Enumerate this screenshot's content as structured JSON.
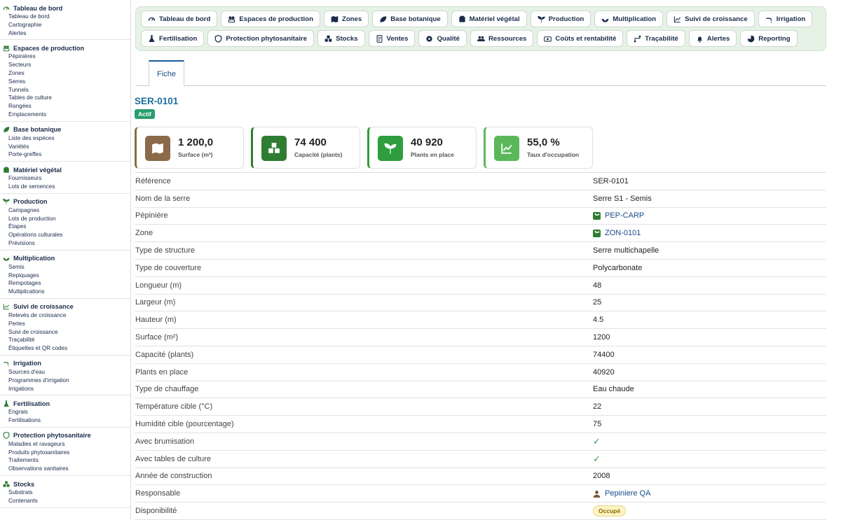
{
  "sidebar": [
    {
      "title": "Tableau de bord",
      "icon": "gauge-icon",
      "items": [
        "Tableau de bord",
        "Cartographie",
        "Alertes"
      ]
    },
    {
      "title": "Espaces de production",
      "icon": "nursery-icon",
      "items": [
        "Pépinières",
        "Secteurs",
        "Zones",
        "Serres",
        "Tunnels",
        "Tables de culture",
        "Rangées",
        "Emplacements"
      ]
    },
    {
      "title": "Base botanique",
      "icon": "leaf-icon",
      "items": [
        "Liste des espèces",
        "Variétés",
        "Porte-greffes"
      ]
    },
    {
      "title": "Matériel végétal",
      "icon": "seed-bag-icon",
      "items": [
        "Fournisseurs",
        "Lots de semences"
      ]
    },
    {
      "title": "Production",
      "icon": "sprout-icon",
      "items": [
        "Campagnes",
        "Lots de production",
        "Étapes",
        "Opérations culturales",
        "Prévisions"
      ]
    },
    {
      "title": "Multiplication",
      "icon": "plant-icon",
      "items": [
        "Semis",
        "Repiquages",
        "Rempotages",
        "Multiplications"
      ]
    },
    {
      "title": "Suivi de croissance",
      "icon": "growth-chart-icon",
      "items": [
        "Relevés de croissance",
        "Pertes",
        "Suivi de croissance",
        "Traçabilité",
        "Étiquettes et QR codes"
      ]
    },
    {
      "title": "Irrigation",
      "icon": "faucet-icon",
      "items": [
        "Sources d'eau",
        "Programmes d'irrigation",
        "Irrigations"
      ]
    },
    {
      "title": "Fertilisation",
      "icon": "flask-icon",
      "items": [
        "Engrais",
        "Fertilisations"
      ]
    },
    {
      "title": "Protection phytosanitaire",
      "icon": "shield-icon",
      "items": [
        "Maladies et ravageurs",
        "Produits phytosanitaires",
        "Traitements",
        "Observations sanitaires"
      ]
    },
    {
      "title": "Stocks",
      "icon": "boxes-icon",
      "items": [
        "Substrats",
        "Contenants"
      ]
    }
  ],
  "topnav": {
    "row1": [
      {
        "label": "Tableau de bord",
        "icon": "gauge-icon"
      },
      {
        "label": "Espaces de production",
        "icon": "nursery-icon"
      },
      {
        "label": "Zones",
        "icon": "map-icon"
      },
      {
        "label": "Base botanique",
        "icon": "leaf-icon"
      },
      {
        "label": "Matériel végétal",
        "icon": "seed-bag-icon"
      },
      {
        "label": "Production",
        "icon": "sprout-icon"
      },
      {
        "label": "Multiplication",
        "icon": "plant-icon"
      },
      {
        "label": "Suivi de croissance",
        "icon": "growth-chart-icon"
      },
      {
        "label": "Irrigation",
        "icon": "faucet-icon"
      }
    ],
    "row2": [
      {
        "label": "Fertilisation",
        "icon": "flask-icon"
      },
      {
        "label": "Protection phytosanitaire",
        "icon": "shield-icon"
      },
      {
        "label": "Stocks",
        "icon": "boxes-icon"
      },
      {
        "label": "Ventes",
        "icon": "receipt-icon"
      },
      {
        "label": "Qualité",
        "icon": "gear-badge-icon"
      },
      {
        "label": "Ressources",
        "icon": "users-icon"
      },
      {
        "label": "Coûts et rentabilité",
        "icon": "money-icon"
      },
      {
        "label": "Traçabilité",
        "icon": "route-icon"
      },
      {
        "label": "Alertes",
        "icon": "bell-icon"
      },
      {
        "label": "Reporting",
        "icon": "pie-chart-icon"
      }
    ]
  },
  "tabs": [
    {
      "label": "Fiche"
    }
  ],
  "record": {
    "title": "SER-0101",
    "status": "Actif"
  },
  "kpis": [
    {
      "value": "1 200,0",
      "label": "Surface (m²)",
      "color": "#8a6a4a",
      "icon": "map-icon"
    },
    {
      "value": "74 400",
      "label": "Capacité (plants)",
      "color": "#2e7d32",
      "icon": "boxes-icon"
    },
    {
      "value": "40 920",
      "label": "Plants en place",
      "color": "#2e9d3e",
      "icon": "seedling-icon"
    },
    {
      "value": "55,0 %",
      "label": "Taux d'occupation",
      "color": "#5ab85a",
      "icon": "growth-chart-icon"
    }
  ],
  "details": [
    {
      "label": "Référence",
      "value": "SER-0101",
      "kind": "text"
    },
    {
      "label": "Nom de la serre",
      "value": "Serre S1 - Semis",
      "kind": "text"
    },
    {
      "label": "Pépinière",
      "value": "PEP-CARP",
      "kind": "link"
    },
    {
      "label": "Zone",
      "value": "ZON-0101",
      "kind": "link"
    },
    {
      "label": "Type de structure",
      "value": "Serre multichapelle",
      "kind": "text"
    },
    {
      "label": "Type de couverture",
      "value": "Polycarbonate",
      "kind": "text"
    },
    {
      "label": "Longueur (m)",
      "value": "48",
      "kind": "text"
    },
    {
      "label": "Largeur (m)",
      "value": "25",
      "kind": "text"
    },
    {
      "label": "Hauteur (m)",
      "value": "4.5",
      "kind": "text"
    },
    {
      "label": "Surface (m²)",
      "value": "1200",
      "kind": "text"
    },
    {
      "label": "Capacité (plants)",
      "value": "74400",
      "kind": "text"
    },
    {
      "label": "Plants en place",
      "value": "40920",
      "kind": "text"
    },
    {
      "label": "Type de chauffage",
      "value": "Eau chaude",
      "kind": "text"
    },
    {
      "label": "Température cible (°C)",
      "value": "22",
      "kind": "text"
    },
    {
      "label": "Humidité cible (pourcentage)",
      "value": "75",
      "kind": "text"
    },
    {
      "label": "Avec brumisation",
      "value": "✓",
      "kind": "check"
    },
    {
      "label": "Avec tables de culture",
      "value": "✓",
      "kind": "check"
    },
    {
      "label": "Année de construction",
      "value": "2008",
      "kind": "text"
    },
    {
      "label": "Responsable",
      "value": "Pepiniere QA",
      "kind": "user"
    },
    {
      "label": "Disponibilité",
      "value": "Occupé",
      "kind": "badge"
    }
  ]
}
